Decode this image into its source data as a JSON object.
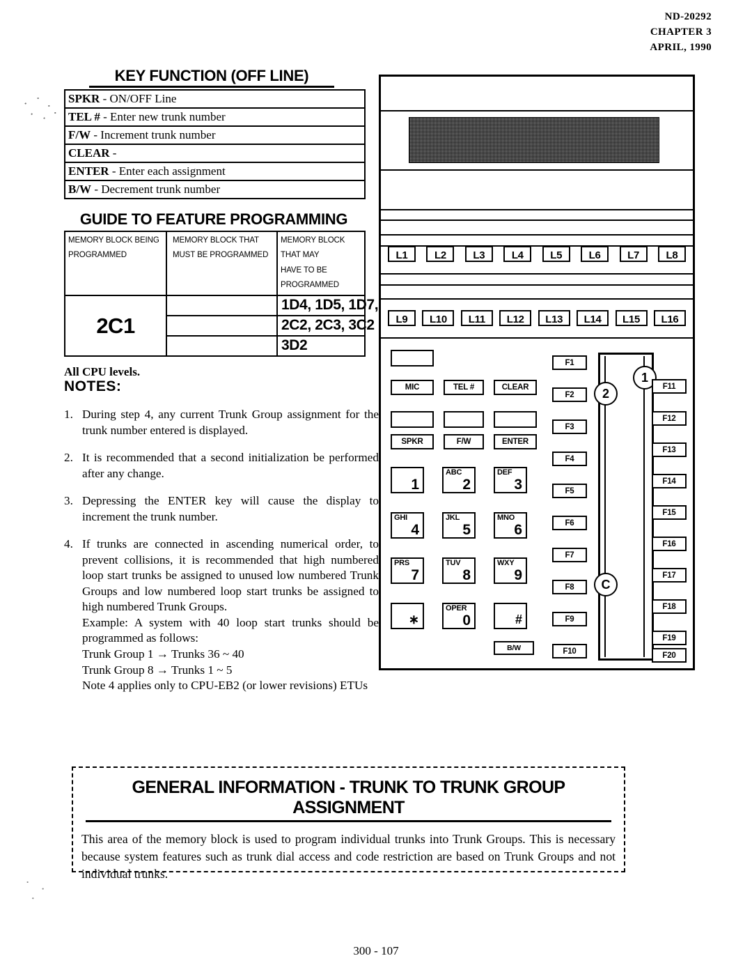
{
  "header": {
    "doc_number": "ND-20292",
    "chapter": "CHAPTER 3",
    "date": "APRIL, 1990"
  },
  "key_function": {
    "title": "KEY FUNCTION (OFF LINE)",
    "rows": [
      {
        "key": "SPKR",
        "desc": "- ON/OFF Line"
      },
      {
        "key": "TEL #",
        "desc": "-  Enter new trunk number"
      },
      {
        "key": "F/W",
        "desc": "-  Increment trunk number"
      },
      {
        "key": "CLEAR",
        "desc": "-"
      },
      {
        "key": "ENTER",
        "desc": "-   Enter each assignment"
      },
      {
        "key": "B/W",
        "desc": "- Decrement trunk number"
      }
    ]
  },
  "guide": {
    "title": "GUIDE TO FEATURE PROGRAMMING",
    "headers": {
      "col1_line1": "MEMORY BLOCK BEING",
      "col1_line2": "PROGRAMMED",
      "col2_line1": "MEMORY BLOCK THAT",
      "col2_line2": "MUST BE PROGRAMMED",
      "col3_line1": "MEMORY BLOCK THAT MAY",
      "col3_line2": "HAVE TO BE PROGRAMMED"
    },
    "block_being_programmed": "2C1",
    "must_be_programmed": [
      "",
      "",
      ""
    ],
    "may_have_to_be_programmed": [
      "1D4, 1D5, 1D7,",
      "2C2, 2C3, 3C2",
      "3D2"
    ]
  },
  "notes": {
    "cpu_levels": "All CPU levels.",
    "label": "NOTES:",
    "items": [
      {
        "num": "1.",
        "text": "During step 4, any current Trunk Group assignment for the trunk number entered is displayed."
      },
      {
        "num": "2.",
        "text": "It is recommended that a second initialization be performed after any change."
      },
      {
        "num": "3.",
        "text": "Depressing the ENTER key will cause the display to increment the trunk number."
      },
      {
        "num": "4.",
        "text": "If trunks are connected in ascending numerical order, to prevent collisions, it is recommended that high numbered loop start trunks be assigned to unused low numbered Trunk Groups and low numbered loop start trunks be assigned to high numbered Trunk Groups.",
        "sub": [
          "Example:   A system with 40 loop start trunks should be programmed as follows:",
          "Trunk Group 1 → Trunks 36 ~ 40",
          "Trunk Group 8 → Trunks 1 ~ 5",
          "Note 4 applies only to CPU-EB2 (or lower revisions) ETUs"
        ]
      }
    ]
  },
  "phone": {
    "line_keys_row1": [
      "L1",
      "L2",
      "L3",
      "L4",
      "L5",
      "L6",
      "L7",
      "L8"
    ],
    "line_keys_row2": [
      "L9",
      "L10",
      "L11",
      "L12",
      "L13",
      "L14",
      "L15",
      "L16"
    ],
    "function_labels_row1": [
      "MIC",
      "TEL #",
      "CLEAR"
    ],
    "function_labels_row2": [
      "SPKR",
      "F/W",
      "ENTER"
    ],
    "bw_label": "B/W",
    "dial_keys": [
      {
        "letters": "",
        "digit": "1"
      },
      {
        "letters": "ABC",
        "digit": "2"
      },
      {
        "letters": "DEF",
        "digit": "3"
      },
      {
        "letters": "GHI",
        "digit": "4"
      },
      {
        "letters": "JKL",
        "digit": "5"
      },
      {
        "letters": "MNO",
        "digit": "6"
      },
      {
        "letters": "PRS",
        "digit": "7"
      },
      {
        "letters": "TUV",
        "digit": "8"
      },
      {
        "letters": "WXY",
        "digit": "9"
      },
      {
        "letters": "",
        "digit": "∗"
      },
      {
        "letters": "OPER",
        "digit": "0"
      },
      {
        "letters": "",
        "digit": "#"
      }
    ],
    "fkeys_left": [
      "F1",
      "F2",
      "F3",
      "F4",
      "F5",
      "F6",
      "F7",
      "F8",
      "F9",
      "F10"
    ],
    "fkeys_right": [
      "F11",
      "F12",
      "F13",
      "F14",
      "F15",
      "F16",
      "F17",
      "F18",
      "F19",
      "F20"
    ],
    "callouts": [
      "1",
      "2",
      "C"
    ]
  },
  "general_info": {
    "title": "GENERAL INFORMATION  -  TRUNK TO TRUNK GROUP  ASSIGNMENT",
    "body": "This area of the memory block is used to program individual trunks into Trunk Groups.  This is necessary because system features such as trunk dial access and code restriction are based on Trunk Groups and not individual trunks."
  },
  "footer": {
    "page": "300 - 107"
  }
}
